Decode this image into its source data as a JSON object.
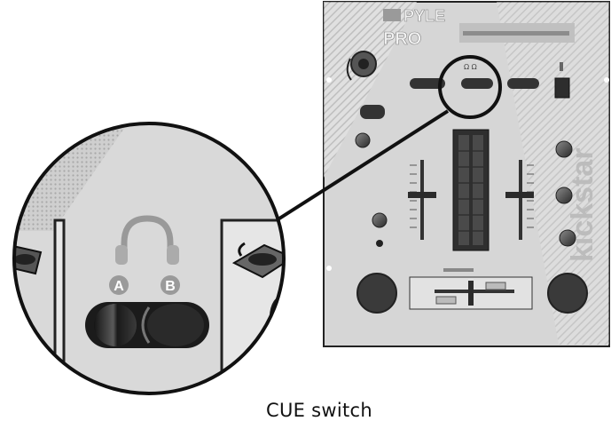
{
  "caption": "CUE switch",
  "brand": {
    "name_top": "PYLE",
    "name_bottom": "PRO",
    "side_lettering": "kickstar"
  },
  "cue_labels": {
    "left": "A",
    "right": "B"
  },
  "callout": {
    "subject": "cue-switch",
    "icon": "headphones-icon"
  },
  "colors": {
    "panel_background": "#d9d9d9",
    "panel_border": "#222222",
    "pattern_stripe": "#b5b5b5",
    "knob": "#3a3a3a",
    "led_meter": "#2f2f2f",
    "label_circle": "#9a9a9a",
    "ink": "#111111"
  }
}
